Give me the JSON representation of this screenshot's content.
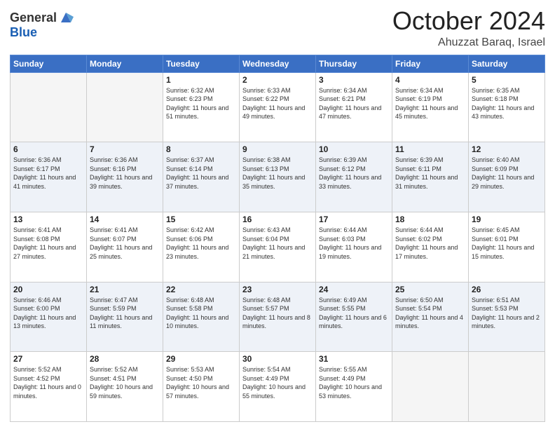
{
  "header": {
    "logo_general": "General",
    "logo_blue": "Blue",
    "month": "October 2024",
    "location": "Ahuzzat Baraq, Israel"
  },
  "days_of_week": [
    "Sunday",
    "Monday",
    "Tuesday",
    "Wednesday",
    "Thursday",
    "Friday",
    "Saturday"
  ],
  "weeks": [
    [
      {
        "day": "",
        "empty": true
      },
      {
        "day": "",
        "empty": true
      },
      {
        "day": "1",
        "sunrise": "Sunrise: 6:32 AM",
        "sunset": "Sunset: 6:23 PM",
        "daylight": "Daylight: 11 hours and 51 minutes."
      },
      {
        "day": "2",
        "sunrise": "Sunrise: 6:33 AM",
        "sunset": "Sunset: 6:22 PM",
        "daylight": "Daylight: 11 hours and 49 minutes."
      },
      {
        "day": "3",
        "sunrise": "Sunrise: 6:34 AM",
        "sunset": "Sunset: 6:21 PM",
        "daylight": "Daylight: 11 hours and 47 minutes."
      },
      {
        "day": "4",
        "sunrise": "Sunrise: 6:34 AM",
        "sunset": "Sunset: 6:19 PM",
        "daylight": "Daylight: 11 hours and 45 minutes."
      },
      {
        "day": "5",
        "sunrise": "Sunrise: 6:35 AM",
        "sunset": "Sunset: 6:18 PM",
        "daylight": "Daylight: 11 hours and 43 minutes."
      }
    ],
    [
      {
        "day": "6",
        "sunrise": "Sunrise: 6:36 AM",
        "sunset": "Sunset: 6:17 PM",
        "daylight": "Daylight: 11 hours and 41 minutes."
      },
      {
        "day": "7",
        "sunrise": "Sunrise: 6:36 AM",
        "sunset": "Sunset: 6:16 PM",
        "daylight": "Daylight: 11 hours and 39 minutes."
      },
      {
        "day": "8",
        "sunrise": "Sunrise: 6:37 AM",
        "sunset": "Sunset: 6:14 PM",
        "daylight": "Daylight: 11 hours and 37 minutes."
      },
      {
        "day": "9",
        "sunrise": "Sunrise: 6:38 AM",
        "sunset": "Sunset: 6:13 PM",
        "daylight": "Daylight: 11 hours and 35 minutes."
      },
      {
        "day": "10",
        "sunrise": "Sunrise: 6:39 AM",
        "sunset": "Sunset: 6:12 PM",
        "daylight": "Daylight: 11 hours and 33 minutes."
      },
      {
        "day": "11",
        "sunrise": "Sunrise: 6:39 AM",
        "sunset": "Sunset: 6:11 PM",
        "daylight": "Daylight: 11 hours and 31 minutes."
      },
      {
        "day": "12",
        "sunrise": "Sunrise: 6:40 AM",
        "sunset": "Sunset: 6:09 PM",
        "daylight": "Daylight: 11 hours and 29 minutes."
      }
    ],
    [
      {
        "day": "13",
        "sunrise": "Sunrise: 6:41 AM",
        "sunset": "Sunset: 6:08 PM",
        "daylight": "Daylight: 11 hours and 27 minutes."
      },
      {
        "day": "14",
        "sunrise": "Sunrise: 6:41 AM",
        "sunset": "Sunset: 6:07 PM",
        "daylight": "Daylight: 11 hours and 25 minutes."
      },
      {
        "day": "15",
        "sunrise": "Sunrise: 6:42 AM",
        "sunset": "Sunset: 6:06 PM",
        "daylight": "Daylight: 11 hours and 23 minutes."
      },
      {
        "day": "16",
        "sunrise": "Sunrise: 6:43 AM",
        "sunset": "Sunset: 6:04 PM",
        "daylight": "Daylight: 11 hours and 21 minutes."
      },
      {
        "day": "17",
        "sunrise": "Sunrise: 6:44 AM",
        "sunset": "Sunset: 6:03 PM",
        "daylight": "Daylight: 11 hours and 19 minutes."
      },
      {
        "day": "18",
        "sunrise": "Sunrise: 6:44 AM",
        "sunset": "Sunset: 6:02 PM",
        "daylight": "Daylight: 11 hours and 17 minutes."
      },
      {
        "day": "19",
        "sunrise": "Sunrise: 6:45 AM",
        "sunset": "Sunset: 6:01 PM",
        "daylight": "Daylight: 11 hours and 15 minutes."
      }
    ],
    [
      {
        "day": "20",
        "sunrise": "Sunrise: 6:46 AM",
        "sunset": "Sunset: 6:00 PM",
        "daylight": "Daylight: 11 hours and 13 minutes."
      },
      {
        "day": "21",
        "sunrise": "Sunrise: 6:47 AM",
        "sunset": "Sunset: 5:59 PM",
        "daylight": "Daylight: 11 hours and 11 minutes."
      },
      {
        "day": "22",
        "sunrise": "Sunrise: 6:48 AM",
        "sunset": "Sunset: 5:58 PM",
        "daylight": "Daylight: 11 hours and 10 minutes."
      },
      {
        "day": "23",
        "sunrise": "Sunrise: 6:48 AM",
        "sunset": "Sunset: 5:57 PM",
        "daylight": "Daylight: 11 hours and 8 minutes."
      },
      {
        "day": "24",
        "sunrise": "Sunrise: 6:49 AM",
        "sunset": "Sunset: 5:55 PM",
        "daylight": "Daylight: 11 hours and 6 minutes."
      },
      {
        "day": "25",
        "sunrise": "Sunrise: 6:50 AM",
        "sunset": "Sunset: 5:54 PM",
        "daylight": "Daylight: 11 hours and 4 minutes."
      },
      {
        "day": "26",
        "sunrise": "Sunrise: 6:51 AM",
        "sunset": "Sunset: 5:53 PM",
        "daylight": "Daylight: 11 hours and 2 minutes."
      }
    ],
    [
      {
        "day": "27",
        "sunrise": "Sunrise: 5:52 AM",
        "sunset": "Sunset: 4:52 PM",
        "daylight": "Daylight: 11 hours and 0 minutes."
      },
      {
        "day": "28",
        "sunrise": "Sunrise: 5:52 AM",
        "sunset": "Sunset: 4:51 PM",
        "daylight": "Daylight: 10 hours and 59 minutes."
      },
      {
        "day": "29",
        "sunrise": "Sunrise: 5:53 AM",
        "sunset": "Sunset: 4:50 PM",
        "daylight": "Daylight: 10 hours and 57 minutes."
      },
      {
        "day": "30",
        "sunrise": "Sunrise: 5:54 AM",
        "sunset": "Sunset: 4:49 PM",
        "daylight": "Daylight: 10 hours and 55 minutes."
      },
      {
        "day": "31",
        "sunrise": "Sunrise: 5:55 AM",
        "sunset": "Sunset: 4:49 PM",
        "daylight": "Daylight: 10 hours and 53 minutes."
      },
      {
        "day": "",
        "empty": true
      },
      {
        "day": "",
        "empty": true
      }
    ]
  ]
}
